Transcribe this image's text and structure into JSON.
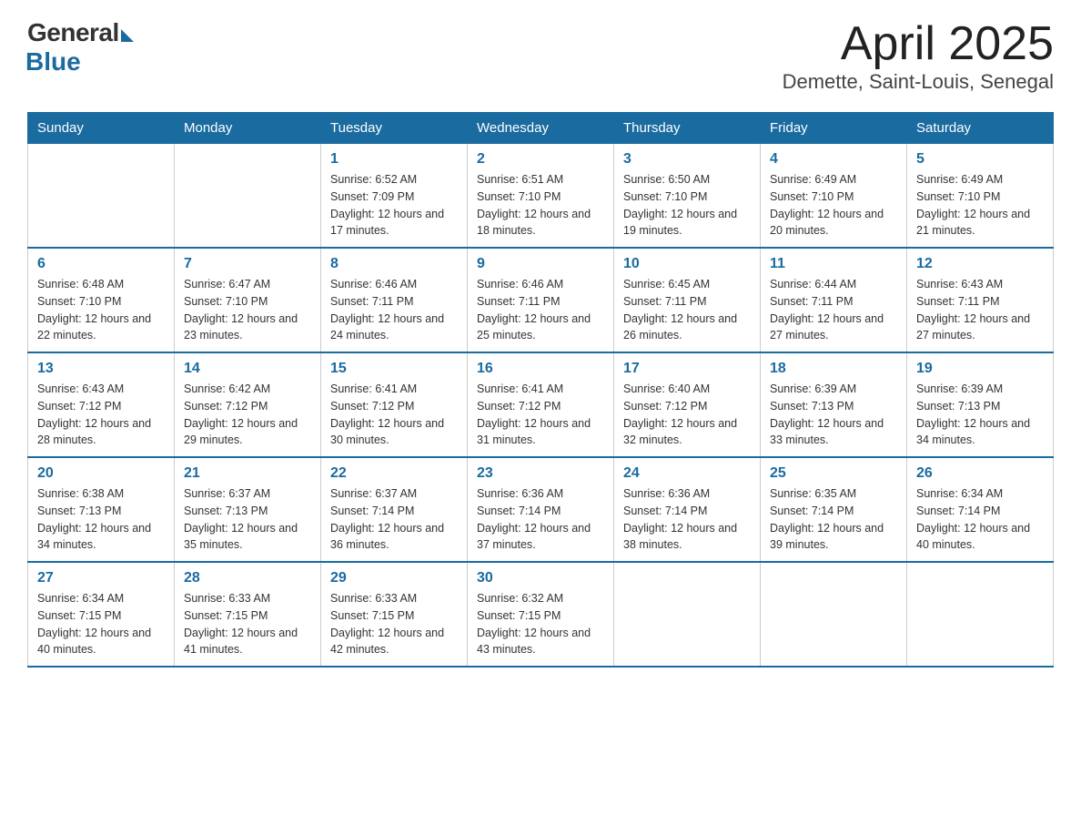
{
  "header": {
    "logo_general": "General",
    "logo_blue": "Blue",
    "title": "April 2025",
    "subtitle": "Demette, Saint-Louis, Senegal"
  },
  "days_of_week": [
    "Sunday",
    "Monday",
    "Tuesday",
    "Wednesday",
    "Thursday",
    "Friday",
    "Saturday"
  ],
  "weeks": [
    [
      {
        "day": "",
        "sunrise": "",
        "sunset": "",
        "daylight": ""
      },
      {
        "day": "",
        "sunrise": "",
        "sunset": "",
        "daylight": ""
      },
      {
        "day": "1",
        "sunrise": "Sunrise: 6:52 AM",
        "sunset": "Sunset: 7:09 PM",
        "daylight": "Daylight: 12 hours and 17 minutes."
      },
      {
        "day": "2",
        "sunrise": "Sunrise: 6:51 AM",
        "sunset": "Sunset: 7:10 PM",
        "daylight": "Daylight: 12 hours and 18 minutes."
      },
      {
        "day": "3",
        "sunrise": "Sunrise: 6:50 AM",
        "sunset": "Sunset: 7:10 PM",
        "daylight": "Daylight: 12 hours and 19 minutes."
      },
      {
        "day": "4",
        "sunrise": "Sunrise: 6:49 AM",
        "sunset": "Sunset: 7:10 PM",
        "daylight": "Daylight: 12 hours and 20 minutes."
      },
      {
        "day": "5",
        "sunrise": "Sunrise: 6:49 AM",
        "sunset": "Sunset: 7:10 PM",
        "daylight": "Daylight: 12 hours and 21 minutes."
      }
    ],
    [
      {
        "day": "6",
        "sunrise": "Sunrise: 6:48 AM",
        "sunset": "Sunset: 7:10 PM",
        "daylight": "Daylight: 12 hours and 22 minutes."
      },
      {
        "day": "7",
        "sunrise": "Sunrise: 6:47 AM",
        "sunset": "Sunset: 7:10 PM",
        "daylight": "Daylight: 12 hours and 23 minutes."
      },
      {
        "day": "8",
        "sunrise": "Sunrise: 6:46 AM",
        "sunset": "Sunset: 7:11 PM",
        "daylight": "Daylight: 12 hours and 24 minutes."
      },
      {
        "day": "9",
        "sunrise": "Sunrise: 6:46 AM",
        "sunset": "Sunset: 7:11 PM",
        "daylight": "Daylight: 12 hours and 25 minutes."
      },
      {
        "day": "10",
        "sunrise": "Sunrise: 6:45 AM",
        "sunset": "Sunset: 7:11 PM",
        "daylight": "Daylight: 12 hours and 26 minutes."
      },
      {
        "day": "11",
        "sunrise": "Sunrise: 6:44 AM",
        "sunset": "Sunset: 7:11 PM",
        "daylight": "Daylight: 12 hours and 27 minutes."
      },
      {
        "day": "12",
        "sunrise": "Sunrise: 6:43 AM",
        "sunset": "Sunset: 7:11 PM",
        "daylight": "Daylight: 12 hours and 27 minutes."
      }
    ],
    [
      {
        "day": "13",
        "sunrise": "Sunrise: 6:43 AM",
        "sunset": "Sunset: 7:12 PM",
        "daylight": "Daylight: 12 hours and 28 minutes."
      },
      {
        "day": "14",
        "sunrise": "Sunrise: 6:42 AM",
        "sunset": "Sunset: 7:12 PM",
        "daylight": "Daylight: 12 hours and 29 minutes."
      },
      {
        "day": "15",
        "sunrise": "Sunrise: 6:41 AM",
        "sunset": "Sunset: 7:12 PM",
        "daylight": "Daylight: 12 hours and 30 minutes."
      },
      {
        "day": "16",
        "sunrise": "Sunrise: 6:41 AM",
        "sunset": "Sunset: 7:12 PM",
        "daylight": "Daylight: 12 hours and 31 minutes."
      },
      {
        "day": "17",
        "sunrise": "Sunrise: 6:40 AM",
        "sunset": "Sunset: 7:12 PM",
        "daylight": "Daylight: 12 hours and 32 minutes."
      },
      {
        "day": "18",
        "sunrise": "Sunrise: 6:39 AM",
        "sunset": "Sunset: 7:13 PM",
        "daylight": "Daylight: 12 hours and 33 minutes."
      },
      {
        "day": "19",
        "sunrise": "Sunrise: 6:39 AM",
        "sunset": "Sunset: 7:13 PM",
        "daylight": "Daylight: 12 hours and 34 minutes."
      }
    ],
    [
      {
        "day": "20",
        "sunrise": "Sunrise: 6:38 AM",
        "sunset": "Sunset: 7:13 PM",
        "daylight": "Daylight: 12 hours and 34 minutes."
      },
      {
        "day": "21",
        "sunrise": "Sunrise: 6:37 AM",
        "sunset": "Sunset: 7:13 PM",
        "daylight": "Daylight: 12 hours and 35 minutes."
      },
      {
        "day": "22",
        "sunrise": "Sunrise: 6:37 AM",
        "sunset": "Sunset: 7:14 PM",
        "daylight": "Daylight: 12 hours and 36 minutes."
      },
      {
        "day": "23",
        "sunrise": "Sunrise: 6:36 AM",
        "sunset": "Sunset: 7:14 PM",
        "daylight": "Daylight: 12 hours and 37 minutes."
      },
      {
        "day": "24",
        "sunrise": "Sunrise: 6:36 AM",
        "sunset": "Sunset: 7:14 PM",
        "daylight": "Daylight: 12 hours and 38 minutes."
      },
      {
        "day": "25",
        "sunrise": "Sunrise: 6:35 AM",
        "sunset": "Sunset: 7:14 PM",
        "daylight": "Daylight: 12 hours and 39 minutes."
      },
      {
        "day": "26",
        "sunrise": "Sunrise: 6:34 AM",
        "sunset": "Sunset: 7:14 PM",
        "daylight": "Daylight: 12 hours and 40 minutes."
      }
    ],
    [
      {
        "day": "27",
        "sunrise": "Sunrise: 6:34 AM",
        "sunset": "Sunset: 7:15 PM",
        "daylight": "Daylight: 12 hours and 40 minutes."
      },
      {
        "day": "28",
        "sunrise": "Sunrise: 6:33 AM",
        "sunset": "Sunset: 7:15 PM",
        "daylight": "Daylight: 12 hours and 41 minutes."
      },
      {
        "day": "29",
        "sunrise": "Sunrise: 6:33 AM",
        "sunset": "Sunset: 7:15 PM",
        "daylight": "Daylight: 12 hours and 42 minutes."
      },
      {
        "day": "30",
        "sunrise": "Sunrise: 6:32 AM",
        "sunset": "Sunset: 7:15 PM",
        "daylight": "Daylight: 12 hours and 43 minutes."
      },
      {
        "day": "",
        "sunrise": "",
        "sunset": "",
        "daylight": ""
      },
      {
        "day": "",
        "sunrise": "",
        "sunset": "",
        "daylight": ""
      },
      {
        "day": "",
        "sunrise": "",
        "sunset": "",
        "daylight": ""
      }
    ]
  ]
}
